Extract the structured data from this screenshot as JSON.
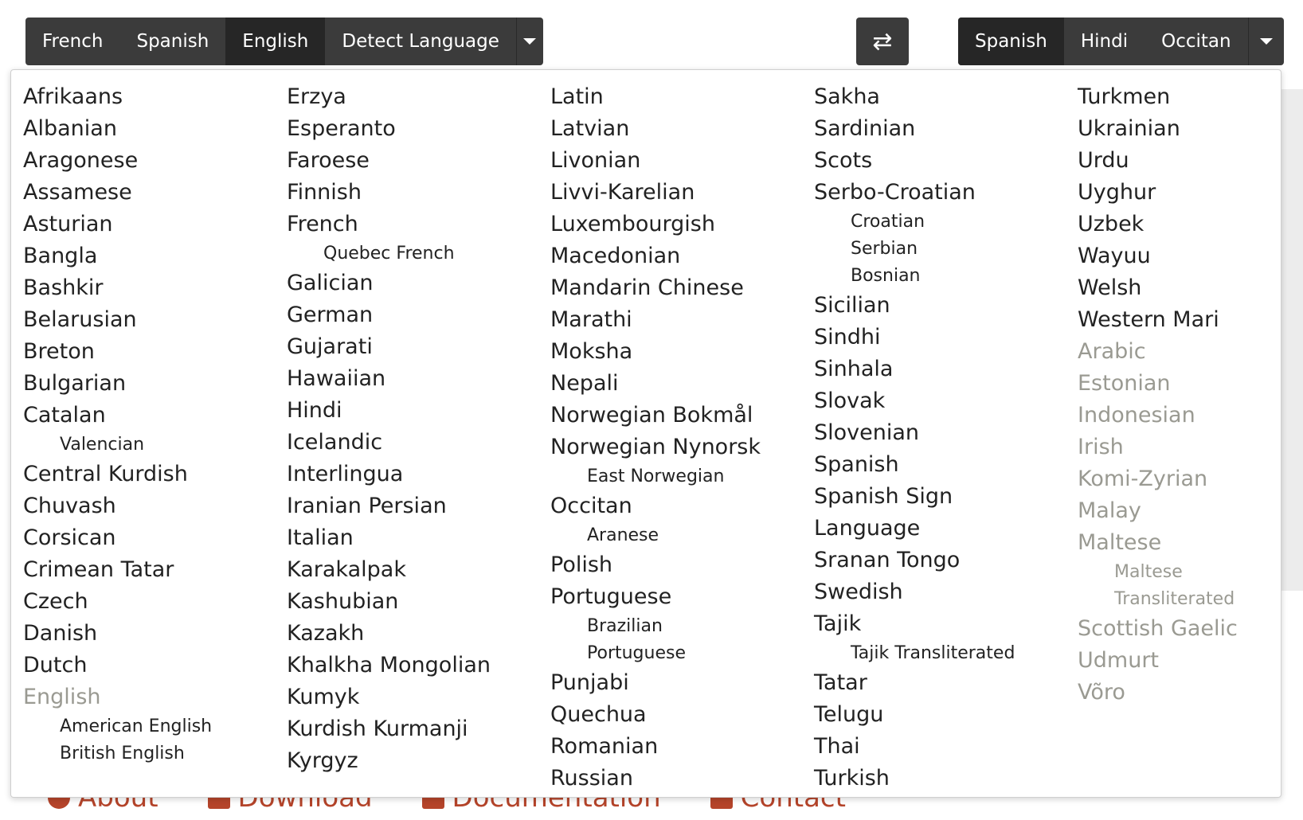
{
  "source_bar": {
    "buttons": [
      {
        "label": "French",
        "active": false
      },
      {
        "label": "Spanish",
        "active": false
      },
      {
        "label": "English",
        "active": true
      },
      {
        "label": "Detect Language",
        "active": false
      }
    ]
  },
  "swap": {
    "icon": "swap-arrows-icon",
    "glyph": "⇄"
  },
  "target_bar": {
    "buttons": [
      {
        "label": "Spanish",
        "active": true
      },
      {
        "label": "Hindi",
        "active": false
      },
      {
        "label": "Occitan",
        "active": false
      }
    ]
  },
  "footer": {
    "links": [
      {
        "label": "About",
        "icon": "info-icon"
      },
      {
        "label": "Download",
        "icon": "download-icon"
      },
      {
        "label": "Documentation",
        "icon": "book-icon"
      },
      {
        "label": "Contact",
        "icon": "envelope-icon"
      }
    ],
    "link_color": "#b5442a"
  },
  "colors": {
    "toolbar_bg": "#3b3b3b",
    "toolbar_active": "#262626",
    "unavailable_text": "#9a9a92"
  },
  "language_columns": [
    [
      {
        "name": "Afrikaans"
      },
      {
        "name": "Albanian"
      },
      {
        "name": "Aragonese"
      },
      {
        "name": "Assamese"
      },
      {
        "name": "Asturian"
      },
      {
        "name": "Bangla"
      },
      {
        "name": "Bashkir"
      },
      {
        "name": "Belarusian"
      },
      {
        "name": "Breton"
      },
      {
        "name": "Bulgarian"
      },
      {
        "name": "Catalan"
      },
      {
        "name": "Valencian",
        "sub": true
      },
      {
        "name": "Central Kurdish"
      },
      {
        "name": "Chuvash"
      },
      {
        "name": "Corsican"
      },
      {
        "name": "Crimean Tatar"
      },
      {
        "name": "Czech"
      },
      {
        "name": "Danish"
      },
      {
        "name": "Dutch"
      },
      {
        "name": "English",
        "dim": true
      },
      {
        "name": "American English",
        "sub": true
      },
      {
        "name": "British English",
        "sub": true
      }
    ],
    [
      {
        "name": "Erzya"
      },
      {
        "name": "Esperanto"
      },
      {
        "name": "Faroese"
      },
      {
        "name": "Finnish"
      },
      {
        "name": "French"
      },
      {
        "name": "Quebec French",
        "sub": true
      },
      {
        "name": "Galician"
      },
      {
        "name": "German"
      },
      {
        "name": "Gujarati"
      },
      {
        "name": "Hawaiian"
      },
      {
        "name": "Hindi"
      },
      {
        "name": "Icelandic"
      },
      {
        "name": "Interlingua"
      },
      {
        "name": "Iranian Persian"
      },
      {
        "name": "Italian"
      },
      {
        "name": "Karakalpak"
      },
      {
        "name": "Kashubian"
      },
      {
        "name": "Kazakh"
      },
      {
        "name": "Khalkha Mongolian"
      },
      {
        "name": "Kumyk"
      },
      {
        "name": "Kurdish Kurmanji"
      },
      {
        "name": "Kyrgyz"
      }
    ],
    [
      {
        "name": "Latin"
      },
      {
        "name": "Latvian"
      },
      {
        "name": "Livonian"
      },
      {
        "name": "Livvi-Karelian"
      },
      {
        "name": "Luxembourgish"
      },
      {
        "name": "Macedonian"
      },
      {
        "name": "Mandarin Chinese"
      },
      {
        "name": "Marathi"
      },
      {
        "name": "Moksha"
      },
      {
        "name": "Nepali"
      },
      {
        "name": "Norwegian Bokmål"
      },
      {
        "name": "Norwegian Nynorsk"
      },
      {
        "name": "East Norwegian",
        "sub": true
      },
      {
        "name": "Occitan"
      },
      {
        "name": "Aranese",
        "sub": true
      },
      {
        "name": "Polish"
      },
      {
        "name": "Portuguese"
      },
      {
        "name": "Brazilian",
        "sub": true
      },
      {
        "name": "Portuguese",
        "sub": true
      },
      {
        "name": "Punjabi"
      },
      {
        "name": "Quechua"
      },
      {
        "name": "Romanian"
      },
      {
        "name": "Russian"
      }
    ],
    [
      {
        "name": "Sakha"
      },
      {
        "name": "Sardinian"
      },
      {
        "name": "Scots"
      },
      {
        "name": "Serbo-Croatian"
      },
      {
        "name": "Croatian",
        "sub": true
      },
      {
        "name": "Serbian",
        "sub": true
      },
      {
        "name": "Bosnian",
        "sub": true
      },
      {
        "name": "Sicilian"
      },
      {
        "name": "Sindhi"
      },
      {
        "name": "Sinhala"
      },
      {
        "name": "Slovak"
      },
      {
        "name": "Slovenian"
      },
      {
        "name": "Spanish"
      },
      {
        "name": "Spanish Sign"
      },
      {
        "name": "Language"
      },
      {
        "name": "Sranan Tongo"
      },
      {
        "name": "Swedish"
      },
      {
        "name": "Tajik"
      },
      {
        "name": "Tajik Transliterated",
        "sub": true
      },
      {
        "name": "Tatar"
      },
      {
        "name": "Telugu"
      },
      {
        "name": "Thai"
      },
      {
        "name": "Turkish"
      }
    ],
    [
      {
        "name": "Turkmen"
      },
      {
        "name": "Ukrainian"
      },
      {
        "name": "Urdu"
      },
      {
        "name": "Uyghur"
      },
      {
        "name": "Uzbek"
      },
      {
        "name": "Wayuu"
      },
      {
        "name": "Welsh"
      },
      {
        "name": "Western Mari"
      },
      {
        "name": "Arabic",
        "dim": true
      },
      {
        "name": "Estonian",
        "dim": true
      },
      {
        "name": "Indonesian",
        "dim": true
      },
      {
        "name": "Irish",
        "dim": true
      },
      {
        "name": "Komi-Zyrian",
        "dim": true
      },
      {
        "name": "Malay",
        "dim": true
      },
      {
        "name": "Maltese",
        "dim": true
      },
      {
        "name": "Maltese",
        "sub": true,
        "dim": true
      },
      {
        "name": "Transliterated",
        "sub": true,
        "dim": true
      },
      {
        "name": "Scottish Gaelic",
        "dim": true
      },
      {
        "name": "Udmurt",
        "dim": true
      },
      {
        "name": "Võro",
        "dim": true
      }
    ]
  ]
}
